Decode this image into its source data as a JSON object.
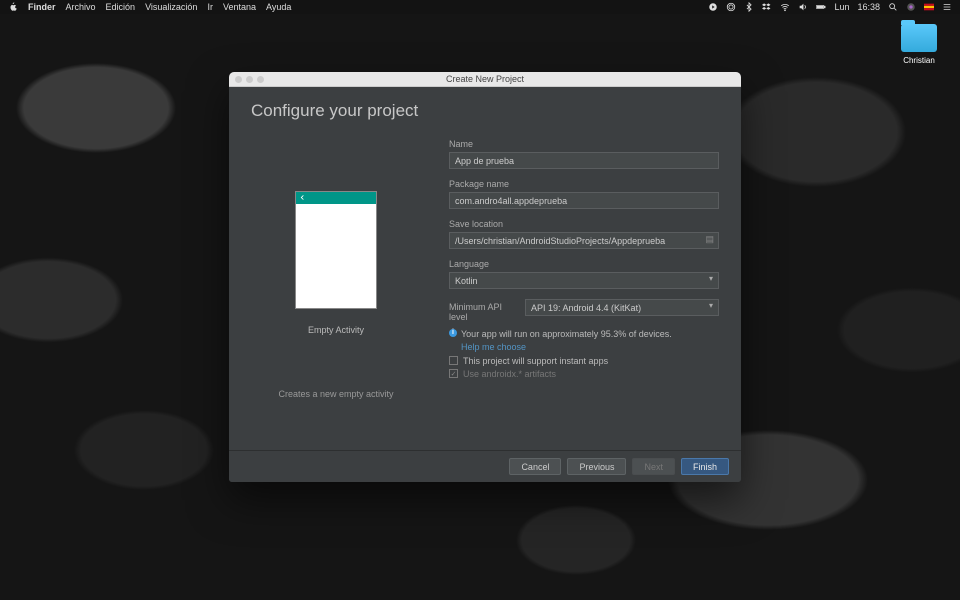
{
  "menubar": {
    "app": "Finder",
    "items": [
      "Archivo",
      "Edición",
      "Visualización",
      "Ir",
      "Ventana",
      "Ayuda"
    ],
    "day": "Lun",
    "time": "16:38"
  },
  "desktop": {
    "folder_label": "Christian"
  },
  "window": {
    "title": "Create New Project",
    "heading": "Configure your project",
    "template_name": "Empty Activity",
    "template_desc": "Creates a new empty activity",
    "fields": {
      "name_label": "Name",
      "name_value": "App de prueba",
      "package_label": "Package name",
      "package_value": "com.andro4all.appdeprueba",
      "save_label": "Save location",
      "save_value": "/Users/christian/AndroidStudioProjects/Appdeprueba",
      "language_label": "Language",
      "language_value": "Kotlin",
      "api_label": "Minimum API level",
      "api_value": "API 19: Android 4.4 (KitKat)"
    },
    "info": {
      "coverage": "Your app will run on approximately 95.3% of devices.",
      "help_link": "Help me choose",
      "instant_apps": "This project will support instant apps",
      "androidx": "Use androidx.* artifacts"
    },
    "buttons": {
      "cancel": "Cancel",
      "previous": "Previous",
      "next": "Next",
      "finish": "Finish"
    }
  }
}
